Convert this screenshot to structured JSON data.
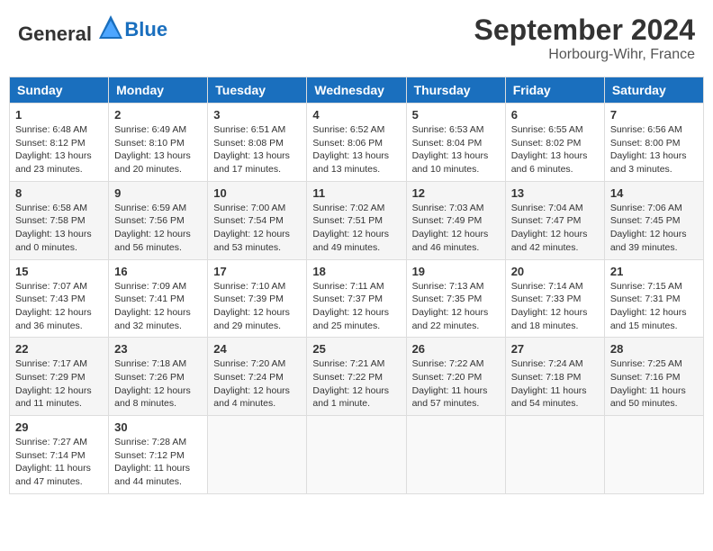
{
  "header": {
    "logo_general": "General",
    "logo_blue": "Blue",
    "title": "September 2024",
    "subtitle": "Horbourg-Wihr, France"
  },
  "calendar": {
    "days_of_week": [
      "Sunday",
      "Monday",
      "Tuesday",
      "Wednesday",
      "Thursday",
      "Friday",
      "Saturday"
    ],
    "weeks": [
      [
        {
          "day": "1",
          "info": "Sunrise: 6:48 AM\nSunset: 8:12 PM\nDaylight: 13 hours\nand 23 minutes."
        },
        {
          "day": "2",
          "info": "Sunrise: 6:49 AM\nSunset: 8:10 PM\nDaylight: 13 hours\nand 20 minutes."
        },
        {
          "day": "3",
          "info": "Sunrise: 6:51 AM\nSunset: 8:08 PM\nDaylight: 13 hours\nand 17 minutes."
        },
        {
          "day": "4",
          "info": "Sunrise: 6:52 AM\nSunset: 8:06 PM\nDaylight: 13 hours\nand 13 minutes."
        },
        {
          "day": "5",
          "info": "Sunrise: 6:53 AM\nSunset: 8:04 PM\nDaylight: 13 hours\nand 10 minutes."
        },
        {
          "day": "6",
          "info": "Sunrise: 6:55 AM\nSunset: 8:02 PM\nDaylight: 13 hours\nand 6 minutes."
        },
        {
          "day": "7",
          "info": "Sunrise: 6:56 AM\nSunset: 8:00 PM\nDaylight: 13 hours\nand 3 minutes."
        }
      ],
      [
        {
          "day": "8",
          "info": "Sunrise: 6:58 AM\nSunset: 7:58 PM\nDaylight: 13 hours\nand 0 minutes."
        },
        {
          "day": "9",
          "info": "Sunrise: 6:59 AM\nSunset: 7:56 PM\nDaylight: 12 hours\nand 56 minutes."
        },
        {
          "day": "10",
          "info": "Sunrise: 7:00 AM\nSunset: 7:54 PM\nDaylight: 12 hours\nand 53 minutes."
        },
        {
          "day": "11",
          "info": "Sunrise: 7:02 AM\nSunset: 7:51 PM\nDaylight: 12 hours\nand 49 minutes."
        },
        {
          "day": "12",
          "info": "Sunrise: 7:03 AM\nSunset: 7:49 PM\nDaylight: 12 hours\nand 46 minutes."
        },
        {
          "day": "13",
          "info": "Sunrise: 7:04 AM\nSunset: 7:47 PM\nDaylight: 12 hours\nand 42 minutes."
        },
        {
          "day": "14",
          "info": "Sunrise: 7:06 AM\nSunset: 7:45 PM\nDaylight: 12 hours\nand 39 minutes."
        }
      ],
      [
        {
          "day": "15",
          "info": "Sunrise: 7:07 AM\nSunset: 7:43 PM\nDaylight: 12 hours\nand 36 minutes."
        },
        {
          "day": "16",
          "info": "Sunrise: 7:09 AM\nSunset: 7:41 PM\nDaylight: 12 hours\nand 32 minutes."
        },
        {
          "day": "17",
          "info": "Sunrise: 7:10 AM\nSunset: 7:39 PM\nDaylight: 12 hours\nand 29 minutes."
        },
        {
          "day": "18",
          "info": "Sunrise: 7:11 AM\nSunset: 7:37 PM\nDaylight: 12 hours\nand 25 minutes."
        },
        {
          "day": "19",
          "info": "Sunrise: 7:13 AM\nSunset: 7:35 PM\nDaylight: 12 hours\nand 22 minutes."
        },
        {
          "day": "20",
          "info": "Sunrise: 7:14 AM\nSunset: 7:33 PM\nDaylight: 12 hours\nand 18 minutes."
        },
        {
          "day": "21",
          "info": "Sunrise: 7:15 AM\nSunset: 7:31 PM\nDaylight: 12 hours\nand 15 minutes."
        }
      ],
      [
        {
          "day": "22",
          "info": "Sunrise: 7:17 AM\nSunset: 7:29 PM\nDaylight: 12 hours\nand 11 minutes."
        },
        {
          "day": "23",
          "info": "Sunrise: 7:18 AM\nSunset: 7:26 PM\nDaylight: 12 hours\nand 8 minutes."
        },
        {
          "day": "24",
          "info": "Sunrise: 7:20 AM\nSunset: 7:24 PM\nDaylight: 12 hours\nand 4 minutes."
        },
        {
          "day": "25",
          "info": "Sunrise: 7:21 AM\nSunset: 7:22 PM\nDaylight: 12 hours\nand 1 minute."
        },
        {
          "day": "26",
          "info": "Sunrise: 7:22 AM\nSunset: 7:20 PM\nDaylight: 11 hours\nand 57 minutes."
        },
        {
          "day": "27",
          "info": "Sunrise: 7:24 AM\nSunset: 7:18 PM\nDaylight: 11 hours\nand 54 minutes."
        },
        {
          "day": "28",
          "info": "Sunrise: 7:25 AM\nSunset: 7:16 PM\nDaylight: 11 hours\nand 50 minutes."
        }
      ],
      [
        {
          "day": "29",
          "info": "Sunrise: 7:27 AM\nSunset: 7:14 PM\nDaylight: 11 hours\nand 47 minutes."
        },
        {
          "day": "30",
          "info": "Sunrise: 7:28 AM\nSunset: 7:12 PM\nDaylight: 11 hours\nand 44 minutes."
        },
        {
          "day": "",
          "info": ""
        },
        {
          "day": "",
          "info": ""
        },
        {
          "day": "",
          "info": ""
        },
        {
          "day": "",
          "info": ""
        },
        {
          "day": "",
          "info": ""
        }
      ]
    ]
  }
}
